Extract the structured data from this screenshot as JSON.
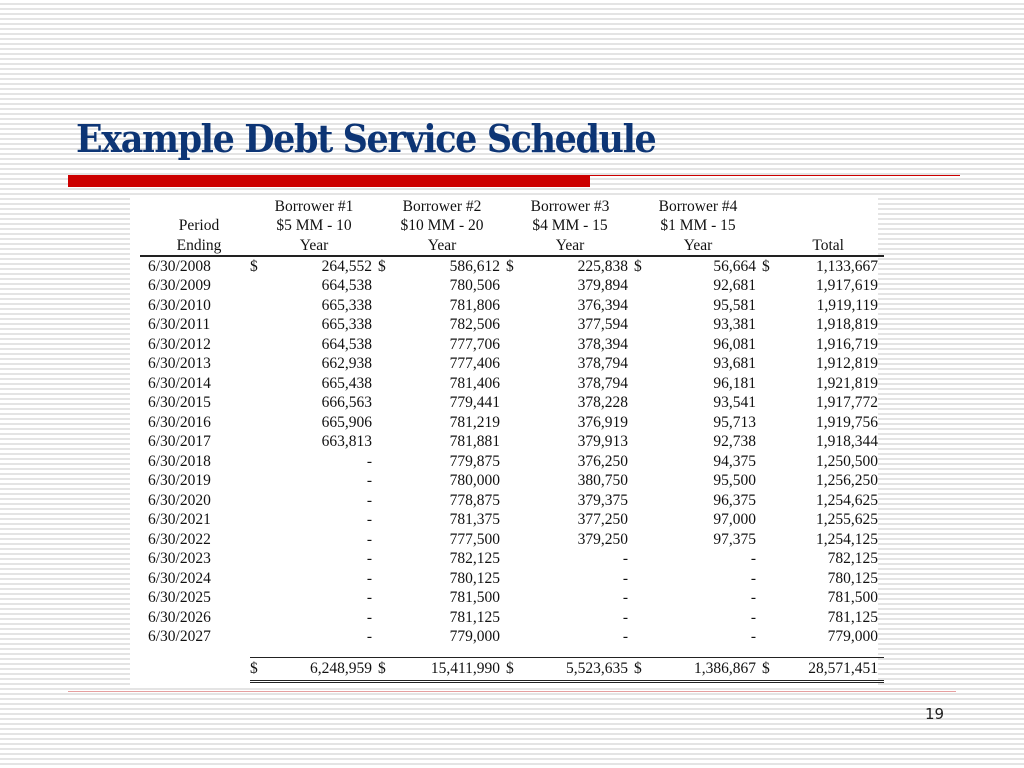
{
  "slide": {
    "title": "Example Debt Service Schedule",
    "page_number": "19",
    "accent_color": "#cc0000",
    "title_color": "#0d3575"
  },
  "table": {
    "headers": {
      "period": [
        "",
        "Period",
        "Ending"
      ],
      "borrower1": [
        "Borrower #1",
        "$5 MM - 10",
        "Year"
      ],
      "borrower2": [
        "Borrower #2",
        "$10 MM - 20",
        "Year"
      ],
      "borrower3": [
        "Borrower #3",
        "$4 MM - 15",
        "Year"
      ],
      "borrower4": [
        "Borrower #4",
        "$1 MM - 15",
        "Year"
      ],
      "total": [
        "",
        "",
        "Total"
      ]
    },
    "currency_symbol": "$",
    "rows": [
      {
        "period": "6/30/2008",
        "b1": "264,552",
        "b2": "586,612",
        "b3": "225,838",
        "b4": "56,664",
        "total": "1,133,667"
      },
      {
        "period": "6/30/2009",
        "b1": "664,538",
        "b2": "780,506",
        "b3": "379,894",
        "b4": "92,681",
        "total": "1,917,619"
      },
      {
        "period": "6/30/2010",
        "b1": "665,338",
        "b2": "781,806",
        "b3": "376,394",
        "b4": "95,581",
        "total": "1,919,119"
      },
      {
        "period": "6/30/2011",
        "b1": "665,338",
        "b2": "782,506",
        "b3": "377,594",
        "b4": "93,381",
        "total": "1,918,819"
      },
      {
        "period": "6/30/2012",
        "b1": "664,538",
        "b2": "777,706",
        "b3": "378,394",
        "b4": "96,081",
        "total": "1,916,719"
      },
      {
        "period": "6/30/2013",
        "b1": "662,938",
        "b2": "777,406",
        "b3": "378,794",
        "b4": "93,681",
        "total": "1,912,819"
      },
      {
        "period": "6/30/2014",
        "b1": "665,438",
        "b2": "781,406",
        "b3": "378,794",
        "b4": "96,181",
        "total": "1,921,819"
      },
      {
        "period": "6/30/2015",
        "b1": "666,563",
        "b2": "779,441",
        "b3": "378,228",
        "b4": "93,541",
        "total": "1,917,772"
      },
      {
        "period": "6/30/2016",
        "b1": "665,906",
        "b2": "781,219",
        "b3": "376,919",
        "b4": "95,713",
        "total": "1,919,756"
      },
      {
        "period": "6/30/2017",
        "b1": "663,813",
        "b2": "781,881",
        "b3": "379,913",
        "b4": "92,738",
        "total": "1,918,344"
      },
      {
        "period": "6/30/2018",
        "b1": "-",
        "b2": "779,875",
        "b3": "376,250",
        "b4": "94,375",
        "total": "1,250,500"
      },
      {
        "period": "6/30/2019",
        "b1": "-",
        "b2": "780,000",
        "b3": "380,750",
        "b4": "95,500",
        "total": "1,256,250"
      },
      {
        "period": "6/30/2020",
        "b1": "-",
        "b2": "778,875",
        "b3": "379,375",
        "b4": "96,375",
        "total": "1,254,625"
      },
      {
        "period": "6/30/2021",
        "b1": "-",
        "b2": "781,375",
        "b3": "377,250",
        "b4": "97,000",
        "total": "1,255,625"
      },
      {
        "period": "6/30/2022",
        "b1": "-",
        "b2": "777,500",
        "b3": "379,250",
        "b4": "97,375",
        "total": "1,254,125"
      },
      {
        "period": "6/30/2023",
        "b1": "-",
        "b2": "782,125",
        "b3": "-",
        "b4": "-",
        "total": "782,125"
      },
      {
        "period": "6/30/2024",
        "b1": "-",
        "b2": "780,125",
        "b3": "-",
        "b4": "-",
        "total": "780,125"
      },
      {
        "period": "6/30/2025",
        "b1": "-",
        "b2": "781,500",
        "b3": "-",
        "b4": "-",
        "total": "781,500"
      },
      {
        "period": "6/30/2026",
        "b1": "-",
        "b2": "781,125",
        "b3": "-",
        "b4": "-",
        "total": "781,125"
      },
      {
        "period": "6/30/2027",
        "b1": "-",
        "b2": "779,000",
        "b3": "-",
        "b4": "-",
        "total": "779,000"
      }
    ],
    "totals": {
      "b1": "6,248,959",
      "b2": "15,411,990",
      "b3": "5,523,635",
      "b4": "1,386,867",
      "total": "28,571,451"
    }
  }
}
